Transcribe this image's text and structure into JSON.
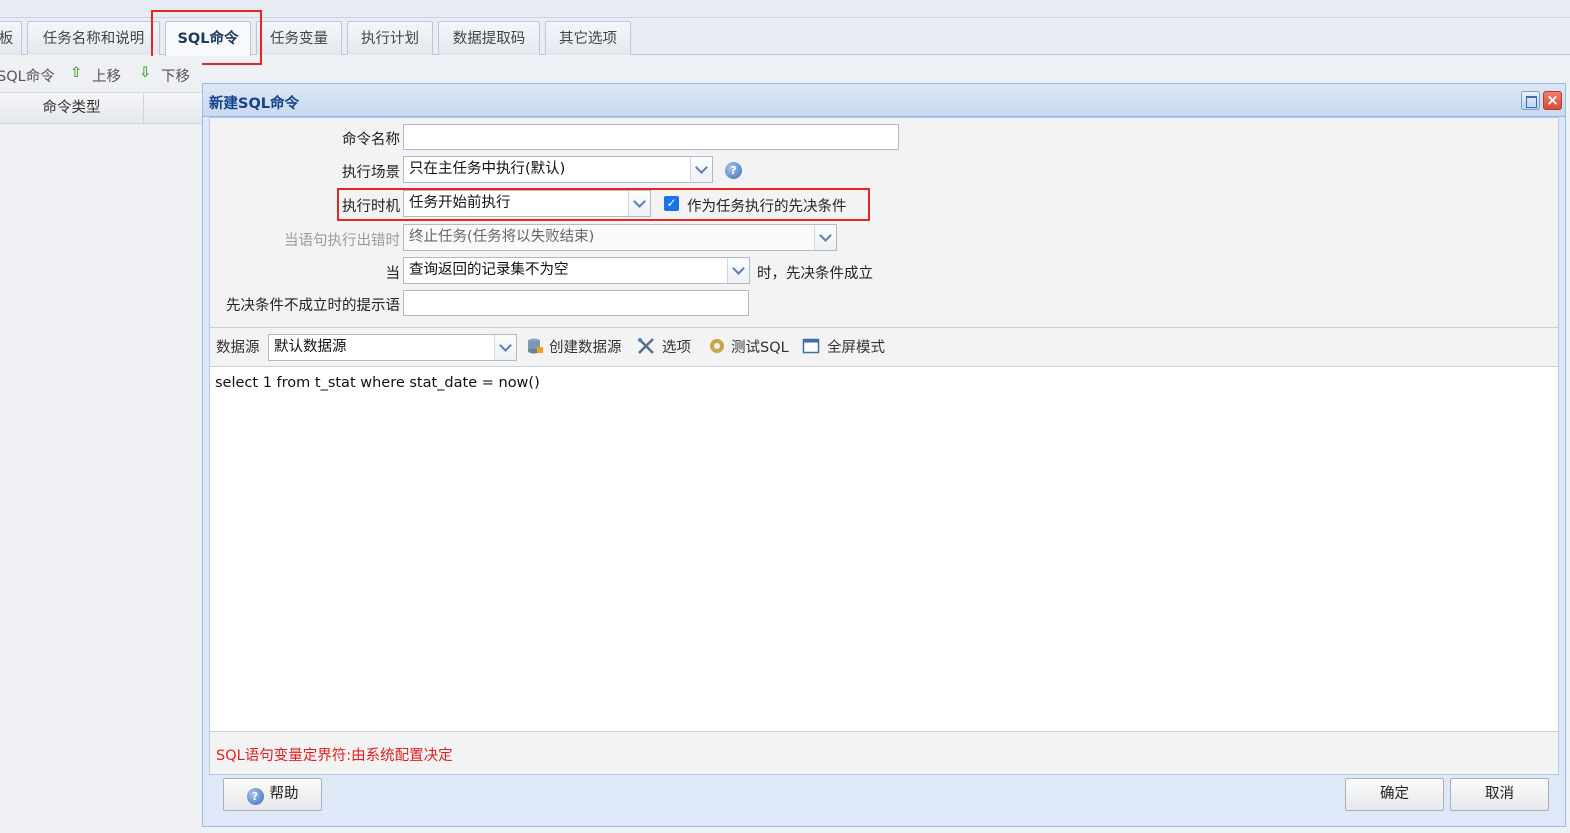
{
  "tabs": [
    {
      "label": "板"
    },
    {
      "label": "任务名称和说明"
    },
    {
      "label": "SQL命令"
    },
    {
      "label": "任务变量"
    },
    {
      "label": "执行计划"
    },
    {
      "label": "数据提取码"
    },
    {
      "label": "其它选项"
    }
  ],
  "left_panel": {
    "toolbar": {
      "new_label": "SQL命令",
      "up_label": "上移",
      "down_label": "下移",
      "up_icon": "arrow-up-icon",
      "down_icon": "arrow-down-icon"
    },
    "column_header": "命令类型"
  },
  "dialog": {
    "title": "新建SQL命令",
    "form": {
      "command_name_label": "命令名称",
      "command_name_value": "",
      "scene_label": "执行场景",
      "scene_value": "只在主任务中执行(默认)",
      "timing_label": "执行时机",
      "timing_value": "任务开始前执行",
      "prerequisite_checked": true,
      "prerequisite_label": "作为任务执行的先决条件",
      "on_error_label": "当语句执行出错时",
      "on_error_value": "终止任务(任务将以失败结束)",
      "when_label": "当",
      "when_value": "查询返回的记录集不为空",
      "when_suffix": "时，先决条件成立",
      "fail_hint_label": "先决条件不成立时的提示语",
      "fail_hint_value": ""
    },
    "datasource_toolbar": {
      "label": "数据源",
      "value": "默认数据源",
      "create_label": "创建数据源",
      "options_label": "选项",
      "test_label": "测试SQL",
      "fullscreen_label": "全屏模式"
    },
    "sql_text": "select 1 from t_stat where stat_date = now()",
    "delimiter_hint": "SQL语句变量定界符:由系统配置决定",
    "buttons": {
      "help": "帮助",
      "ok": "确定",
      "cancel": "取消"
    }
  },
  "colors": {
    "highlight_border": "#e8261f",
    "hint_text": "#e02020",
    "checkbox": "#1a73e8"
  }
}
